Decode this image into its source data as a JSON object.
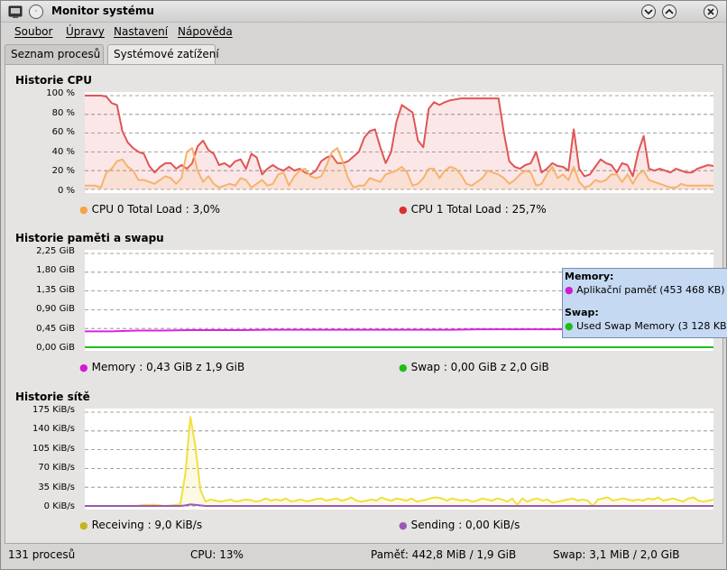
{
  "window": {
    "title": "Monitor systému",
    "icon_name": "terminal-monitor-icon",
    "menu_button_glyph": "·",
    "minimize_icon": "chevron-down-icon",
    "maximize_icon": "chevron-up-icon"
  },
  "menubar": {
    "items": [
      {
        "label": "Soubor"
      },
      {
        "label": "Úpravy"
      },
      {
        "label": "Nastavení"
      },
      {
        "label": "Nápověda"
      }
    ]
  },
  "tabs": [
    {
      "label": "Seznam procesů",
      "active": false
    },
    {
      "label": "Systémové zatížení",
      "active": true
    }
  ],
  "cpu": {
    "title": "Historie CPU",
    "y_ticks": [
      "100 %",
      "80 %",
      "60 %",
      "40 %",
      "20 %",
      "0 %"
    ],
    "legend": [
      {
        "label": "CPU 0 Total Load : 3,0%",
        "color": "#f5a343"
      },
      {
        "label": "CPU 1 Total Load : 25,7%",
        "color": "#d93030"
      }
    ]
  },
  "memory": {
    "title": "Historie paměti a swapu",
    "y_ticks": [
      "2,25 GiB",
      "1,80 GiB",
      "1,35 GiB",
      "0,90 GiB",
      "0,45 GiB",
      "0,00 GiB"
    ],
    "legend": [
      {
        "label": "Memory : 0,43 GiB z 1,9 GiB",
        "color": "#d21bd2"
      },
      {
        "label": "Swap : 0,00 GiB z 2,0 GiB",
        "color": "#1bbf1b"
      }
    ],
    "tooltip": {
      "memory_heading": "Memory:",
      "memory_row": "Aplikační paměť (453 468 KB)",
      "swap_heading": "Swap:",
      "swap_row": "Used Swap Memory (3 128 KB)"
    }
  },
  "network": {
    "title": "Historie sítě",
    "y_ticks": [
      "175 KiB/s",
      "140 KiB/s",
      "105 KiB/s",
      "70 KiB/s",
      "35 KiB/s",
      "0 KiB/s"
    ],
    "legend": [
      {
        "label": "Receiving : 9,0 KiB/s",
        "color": "#c8b41e"
      },
      {
        "label": "Sending : 0,00 KiB/s",
        "color": "#9b59b6"
      }
    ]
  },
  "statusbar": {
    "processes": "131 procesů",
    "cpu": "CPU: 13%",
    "memory": "Paměť: 442,8 MiB / 1,9 GiB",
    "swap": "Swap: 3,1 MiB / 2,0 GiB"
  },
  "chart_data": [
    {
      "type": "area",
      "title": "Historie CPU",
      "ylim": [
        0,
        100
      ],
      "y_unit": "%",
      "grid": true,
      "series": [
        {
          "name": "CPU 1 Total Load",
          "color": "#e05555",
          "values": [
            100,
            100,
            100,
            100,
            99,
            92,
            90,
            62,
            50,
            44,
            40,
            38,
            25,
            18,
            24,
            28,
            28,
            22,
            26,
            22,
            28,
            46,
            52,
            42,
            38,
            26,
            28,
            24,
            30,
            32,
            22,
            38,
            34,
            16,
            22,
            26,
            22,
            20,
            24,
            20,
            22,
            18,
            16,
            20,
            30,
            34,
            36,
            28,
            28,
            30,
            35,
            40,
            55,
            62,
            64,
            45,
            28,
            40,
            72,
            90,
            86,
            82,
            52,
            45,
            86,
            93,
            90,
            93,
            95,
            96,
            97,
            97,
            97,
            97,
            97,
            97,
            97,
            97,
            60,
            30,
            24,
            22,
            26,
            28,
            40,
            18,
            22,
            28,
            25,
            24,
            20,
            64,
            22,
            14,
            16,
            24,
            32,
            28,
            26,
            18,
            28,
            26,
            14,
            40,
            57,
            22,
            20,
            22,
            20,
            18,
            22,
            20,
            18,
            18,
            22,
            24,
            26,
            25
          ]
        },
        {
          "name": "CPU 0 Total Load",
          "color": "#f6b36b",
          "values": [
            4,
            4,
            4,
            2,
            18,
            22,
            30,
            32,
            24,
            20,
            10,
            10,
            8,
            6,
            10,
            14,
            12,
            6,
            12,
            40,
            44,
            20,
            8,
            14,
            6,
            2,
            4,
            6,
            4,
            12,
            10,
            2,
            6,
            10,
            4,
            6,
            16,
            18,
            4,
            14,
            20,
            22,
            14,
            12,
            14,
            26,
            40,
            44,
            30,
            12,
            2,
            4,
            4,
            12,
            10,
            8,
            16,
            18,
            20,
            24,
            18,
            4,
            6,
            12,
            22,
            22,
            12,
            20,
            24,
            22,
            16,
            6,
            4,
            8,
            12,
            20,
            18,
            16,
            12,
            6,
            10,
            16,
            20,
            18,
            4,
            6,
            16,
            24,
            12,
            16,
            10,
            24,
            8,
            2,
            4,
            10,
            8,
            10,
            16,
            16,
            8,
            16,
            6,
            16,
            20,
            10,
            8,
            6,
            4,
            2,
            2,
            6,
            4,
            4,
            4,
            4,
            4,
            4
          ]
        }
      ]
    },
    {
      "type": "line",
      "title": "Historie paměti a swapu",
      "ylim": [
        0,
        2.25
      ],
      "y_unit": "GiB",
      "grid": true,
      "series": [
        {
          "name": "Memory",
          "color": "#e020e0",
          "values": [
            0.38,
            0.38,
            0.4,
            0.4,
            0.41,
            0.41,
            0.41,
            0.42,
            0.42,
            0.42,
            0.42,
            0.42,
            0.42,
            0.42,
            0.42,
            0.43,
            0.43,
            0.43,
            0.43,
            0.43,
            0.43,
            0.43,
            0.43,
            0.43,
            0.43
          ]
        },
        {
          "name": "Swap",
          "color": "#20c020",
          "values": [
            0.0,
            0.0,
            0.0,
            0.0,
            0.0,
            0.0,
            0.0,
            0.0,
            0.0,
            0.0,
            0.0,
            0.0,
            0.0,
            0.0,
            0.0,
            0.0,
            0.0,
            0.0,
            0.0,
            0.0,
            0.0,
            0.0,
            0.0,
            0.0,
            0.0
          ]
        }
      ]
    },
    {
      "type": "area",
      "title": "Historie sítě",
      "ylim": [
        0,
        175
      ],
      "y_unit": "KiB/s",
      "grid": true,
      "series": [
        {
          "name": "Receiving",
          "color": "#f0e040",
          "values": [
            0,
            0,
            0,
            0,
            0,
            0,
            0,
            0,
            0,
            0,
            0,
            1,
            2,
            2,
            2,
            1,
            0,
            1,
            2,
            3,
            60,
            166,
            110,
            30,
            8,
            12,
            10,
            8,
            10,
            12,
            8,
            10,
            12,
            11,
            8,
            10,
            14,
            10,
            12,
            10,
            14,
            8,
            10,
            12,
            9,
            10,
            13,
            14,
            10,
            12,
            14,
            10,
            12,
            16,
            10,
            8,
            10,
            12,
            10,
            16,
            12,
            10,
            14,
            12,
            10,
            14,
            8,
            10,
            12,
            15,
            16,
            14,
            10,
            14,
            12,
            10,
            12,
            8,
            10,
            14,
            12,
            10,
            14,
            12,
            8,
            14,
            2,
            14,
            8,
            12,
            14,
            10,
            12,
            6,
            8,
            10,
            12,
            14,
            10,
            12,
            10,
            0,
            12,
            14,
            16,
            10,
            12,
            14,
            12,
            10,
            12,
            10,
            14,
            12,
            16,
            10,
            12,
            14,
            11,
            8,
            14,
            16,
            10,
            8,
            10,
            12
          ]
        },
        {
          "name": "Sending",
          "color": "#9b59b6",
          "values": [
            0,
            0,
            0,
            0,
            0,
            0,
            0,
            0,
            0,
            0,
            0,
            0,
            0,
            0,
            0,
            0,
            0,
            0,
            0,
            0,
            1,
            3,
            2,
            1,
            0,
            0,
            0,
            0,
            0,
            0,
            0,
            0,
            0,
            0,
            0,
            0,
            0,
            0,
            0,
            0,
            0,
            0,
            0,
            0,
            0,
            0,
            0,
            0,
            0,
            0,
            0,
            0,
            0,
            0,
            0,
            0,
            0,
            0,
            0,
            0,
            0,
            0,
            0,
            0,
            0,
            0,
            0,
            0,
            0,
            0,
            0,
            0,
            0,
            0,
            0,
            0,
            0,
            0,
            0,
            0,
            0,
            0,
            0,
            0,
            0,
            0,
            0,
            0,
            0,
            0,
            0,
            0,
            0,
            0,
            0,
            0,
            0,
            0,
            0,
            0,
            0,
            0,
            0,
            0,
            0,
            0,
            0,
            0,
            0,
            0,
            0,
            0,
            0,
            0,
            0,
            0,
            0,
            0,
            0,
            0,
            0,
            0,
            0,
            0,
            0,
            0
          ]
        }
      ]
    }
  ]
}
